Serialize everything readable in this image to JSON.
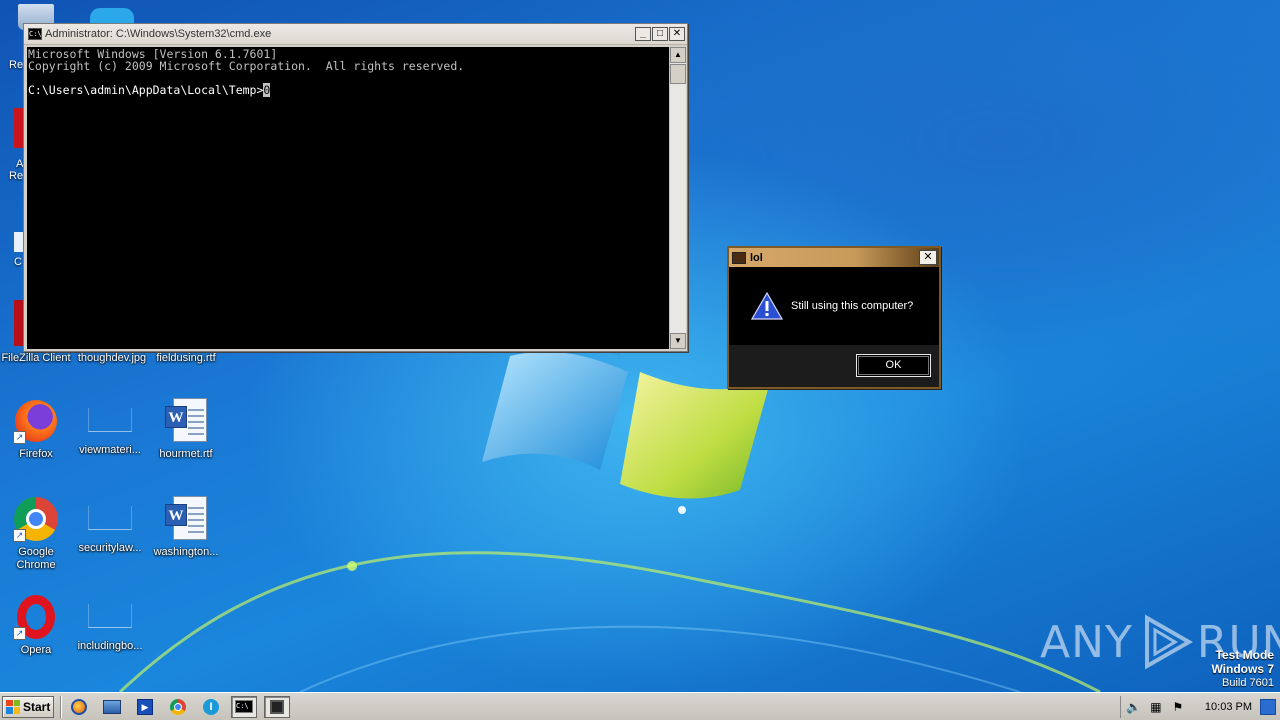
{
  "desktop": {
    "icons": [
      {
        "label": "FileZilla Client",
        "icon": "filezilla-icon"
      },
      {
        "label": "thoughdev.jpg",
        "icon": "image-file-icon"
      },
      {
        "label": "fieldusing.rtf",
        "icon": "rtf-file-icon"
      },
      {
        "label": "Firefox",
        "icon": "firefox-icon"
      },
      {
        "label": "viewmateri...",
        "icon": "blank-file-icon"
      },
      {
        "label": "hourmet.rtf",
        "icon": "word-doc-icon"
      },
      {
        "label": "Google Chrome",
        "icon": "chrome-icon"
      },
      {
        "label": "securitylaw...",
        "icon": "blank-file-icon"
      },
      {
        "label": "washington...",
        "icon": "word-doc-icon"
      },
      {
        "label": "Opera",
        "icon": "opera-icon"
      },
      {
        "label": "includingbo...",
        "icon": "blank-file-icon"
      }
    ],
    "edge_labels": [
      "Re",
      "A",
      "Re",
      "C"
    ]
  },
  "cmd_window": {
    "title": "Administrator: C:\\Windows\\System32\\cmd.exe",
    "icon_text": "C:\\",
    "line1": "Microsoft Windows [Version 6.1.7601]",
    "line2": "Copyright (c) 2009 Microsoft Corporation.  All rights reserved.",
    "prompt": "C:\\Users\\admin\\AppData\\Local\\Temp>",
    "typed": "0",
    "buttons": {
      "minimize": "_",
      "maximize": "□",
      "close": "✕"
    }
  },
  "message_box": {
    "title": "lol",
    "message": "Still using this computer?",
    "ok_label": "OK",
    "close_label": "✕"
  },
  "watermark": {
    "brand_left": "ANY",
    "brand_right": "RUN",
    "test_mode": "Test Mode",
    "os": "Windows 7",
    "build": "Build 7601"
  },
  "taskbar": {
    "start_label": "Start",
    "pinned": [
      "ie-icon",
      "explorer-icon",
      "media-player-icon",
      "chrome-icon",
      "opera-icon",
      "cmd-icon",
      "app-icon"
    ],
    "clock": "10:03 PM"
  },
  "colors": {
    "desktop_blue": "#1a78d4",
    "msgbox_title_gold": "#c89a5a",
    "console_bg": "#000000",
    "taskbar": "#d4d0c8"
  }
}
